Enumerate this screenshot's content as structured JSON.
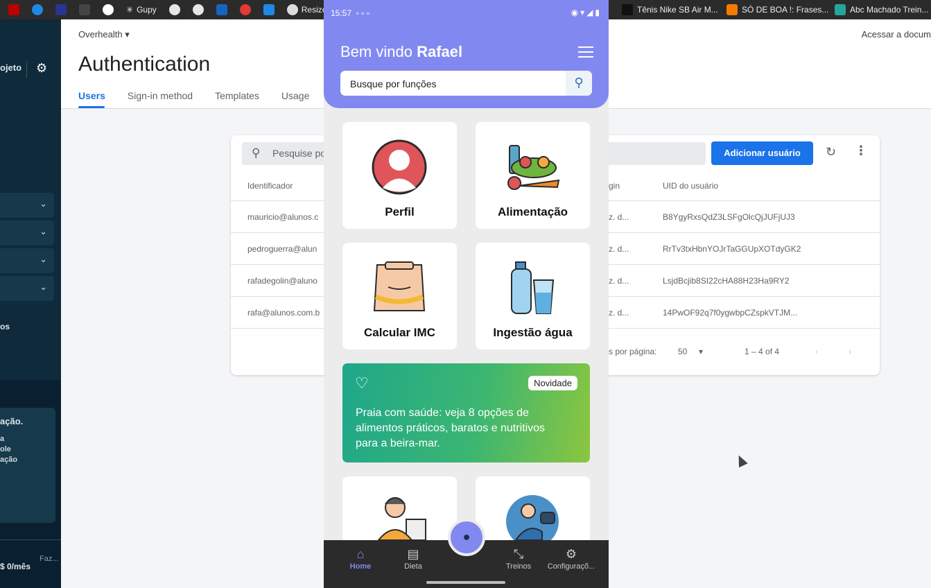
{
  "bookmarks": [
    "Gupy",
    "Resizel",
    "Tênis Nike SB Air M...",
    "SÓ DE BOA !: Frases...",
    "Abc Machado Trein..."
  ],
  "sidebar": {
    "project_label": "ojeto",
    "menu_items_count_label": "",
    "section_label": "os",
    "card_title": "ação.",
    "card_lines": [
      "a",
      "ole",
      "ação"
    ],
    "price": "$ 0/mês",
    "faz": "Faz..."
  },
  "console": {
    "project_select": "Overhealth",
    "access_docs": "Acessar a docum",
    "title": "Authentication",
    "tabs": [
      "Users",
      "Sign-in method",
      "Templates",
      "Usage"
    ],
    "search_placeholder": "Pesquise po",
    "add_user_button": "Adicionar usuário",
    "columns": {
      "identifier": "Identificador",
      "signin": "gin",
      "uid": "UID do usuário"
    },
    "rows": [
      {
        "email": "mauricio@alunos.c",
        "signin": "z. d...",
        "uid": "B8YgyRxsQdZ3LSFgOlcQjJUFjUJ3"
      },
      {
        "email": "pedroguerra@alun",
        "signin": "z. d...",
        "uid": "RrTv3txHbnYOJrTaGGUpXOTdyGK2"
      },
      {
        "email": "rafadegolin@aluno",
        "signin": "z. d...",
        "uid": "LsjdBcjib8SI22cHA88H23Ha9RY2"
      },
      {
        "email": "rafa@alunos.com.b",
        "signin": "z. d...",
        "uid": "14PwOF92q7f0ygwbpCZspkVTJM..."
      }
    ],
    "rows_per_page_label": "s por página:",
    "rows_per_page": "50",
    "range": "1 – 4 of 4"
  },
  "app": {
    "time": "15:57",
    "welcome": "Bem vindo",
    "user_name": "Rafael",
    "search_placeholder": "Busque por funções",
    "tiles": [
      "Perfil",
      "Alimentação",
      "Calcular IMC",
      "Ingestão água"
    ],
    "promo_badge": "Novidade",
    "promo_text": "Praia com saúde: veja 8 opções de alimentos práticos, baratos e nutritivos para a beira-mar.",
    "nav": [
      "Home",
      "Dieta",
      "Treinos",
      "Configuraçõ..."
    ],
    "accent": "#8189f0"
  }
}
